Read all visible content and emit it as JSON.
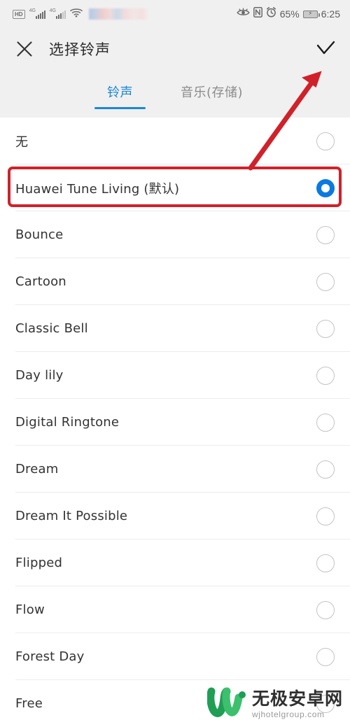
{
  "status_bar": {
    "hd_label": "HD",
    "sim1_network": "4G",
    "sim2_network": "4G",
    "wifi_icon": "wifi-icon",
    "carrier_blurred": "",
    "eye_comfort_icon": "eye-icon",
    "nfc_label": "N",
    "alarm_icon": "alarm-clock-icon",
    "battery_percent": "65%",
    "battery_state": "charging",
    "time": "6:25"
  },
  "header": {
    "close_icon": "close-icon",
    "title": "选择铃声",
    "confirm_icon": "check-icon"
  },
  "tabs": {
    "items": [
      {
        "label": "铃声",
        "active": true
      },
      {
        "label": "音乐(存储)",
        "active": false
      }
    ],
    "active_color": "#1a87d8",
    "inactive_color": "#8b8b8b"
  },
  "ringtone_list": {
    "selected_index": 1,
    "items": [
      {
        "label": "无",
        "selected": false
      },
      {
        "label": "Huawei Tune Living (默认)",
        "selected": true
      },
      {
        "label": "Bounce",
        "selected": false
      },
      {
        "label": "Cartoon",
        "selected": false
      },
      {
        "label": "Classic Bell",
        "selected": false
      },
      {
        "label": "Day lily",
        "selected": false
      },
      {
        "label": "Digital Ringtone",
        "selected": false
      },
      {
        "label": "Dream",
        "selected": false
      },
      {
        "label": "Dream It Possible",
        "selected": false
      },
      {
        "label": "Flipped",
        "selected": false
      },
      {
        "label": "Flow",
        "selected": false
      },
      {
        "label": "Forest Day",
        "selected": false
      },
      {
        "label": "Free",
        "selected": false
      }
    ]
  },
  "annotations": {
    "highlight_color": "#d0212a",
    "arrow_color": "#d0212a",
    "highlight_target": "Huawei Tune Living (默认)",
    "arrow_target": "check-icon"
  },
  "watermark": {
    "logo_icon": "w-logo-icon",
    "site_name": "无极安卓网",
    "site_url": "wjhotelgroup.com",
    "logo_color": "#22a05a"
  }
}
